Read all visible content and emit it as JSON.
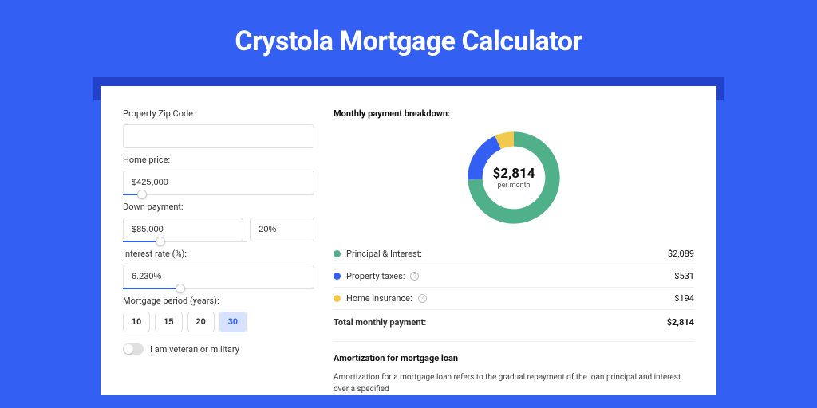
{
  "header": {
    "title": "Crystola Mortgage Calculator"
  },
  "form": {
    "zip_label": "Property Zip Code:",
    "zip_value": "",
    "home_price_label": "Home price:",
    "home_price_value": "$425,000",
    "home_price_slider_pct": 10,
    "down_payment_label": "Down payment:",
    "down_payment_amount": "$85,000",
    "down_payment_pct": "20%",
    "down_payment_slider_pct": 20,
    "interest_label": "Interest rate (%):",
    "interest_value": "6.230%",
    "interest_slider_pct": 30,
    "period_label": "Mortgage period (years):",
    "period_options": [
      "10",
      "15",
      "20",
      "30"
    ],
    "period_selected": "30",
    "veteran_label": "I am veteran or military"
  },
  "breakdown": {
    "title": "Monthly payment breakdown:",
    "center_amount": "$2,814",
    "center_sub": "per month",
    "items": [
      {
        "label": "Principal & Interest:",
        "value": "$2,089",
        "color": "green",
        "info": false
      },
      {
        "label": "Property taxes:",
        "value": "$531",
        "color": "blue",
        "info": true
      },
      {
        "label": "Home insurance:",
        "value": "$194",
        "color": "yellow",
        "info": true
      }
    ],
    "total_label": "Total monthly payment:",
    "total_value": "$2,814"
  },
  "chart_data": {
    "type": "pie",
    "title": "Monthly payment breakdown",
    "series": [
      {
        "name": "Principal & Interest",
        "value": 2089,
        "color": "#4fb08a"
      },
      {
        "name": "Property taxes",
        "value": 531,
        "color": "#3360f3"
      },
      {
        "name": "Home insurance",
        "value": 194,
        "color": "#f2c94c"
      }
    ],
    "total": 2814,
    "center_label": "$2,814 per month"
  },
  "amortization": {
    "title": "Amortization for mortgage loan",
    "text": "Amortization for a mortgage loan refers to the gradual repayment of the loan principal and interest over a specified"
  }
}
